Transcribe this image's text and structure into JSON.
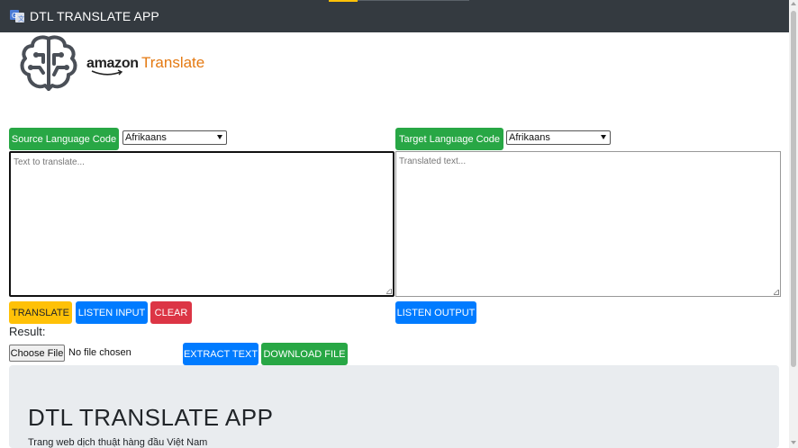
{
  "navbar": {
    "title": "DTL TRANSLATE APP",
    "icon": "translate-icon",
    "background": "#343a40",
    "accent": "#ffc107"
  },
  "logo": {
    "amazon": "amazon",
    "product": "Translate",
    "icon": "brain-circuit-icon",
    "product_color": "#e47911"
  },
  "source": {
    "label": "Source Language Code",
    "selected": "Afrikaans",
    "placeholder": "Text to translate..."
  },
  "target": {
    "label": "Target Language Code",
    "selected": "Afrikaans",
    "placeholder": "Translated text..."
  },
  "actions": {
    "translate": "TRANSLATE",
    "listen_input": "LISTEN INPUT",
    "clear": "CLEAR",
    "listen_output": "LISTEN OUTPUT"
  },
  "result": {
    "label": "Result:"
  },
  "file": {
    "choose": "Choose File",
    "status": "No file chosen",
    "extract": "EXTRACT TEXT",
    "download": "DOWNLOAD FILE"
  },
  "jumbotron": {
    "title": "DTL TRANSLATE APP",
    "subtitle": "Trang web dịch thuật hàng đầu Việt Nam"
  },
  "colors": {
    "green": "#28a745",
    "blue": "#007bff",
    "red": "#dc3545",
    "yellow": "#ffc107"
  }
}
